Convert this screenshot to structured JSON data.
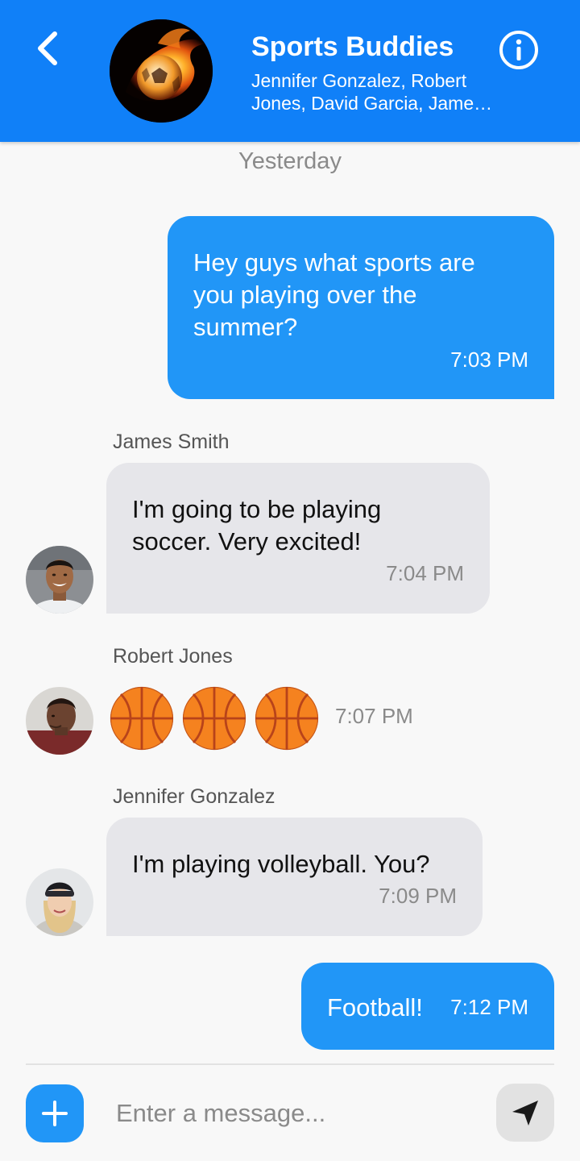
{
  "header": {
    "title": "Sports Buddies",
    "members": "Jennifer Gonzalez, Robert Jones, David Garcia, James Smith",
    "back_icon": "chevron-left-icon",
    "info_icon": "info-icon",
    "accent_color": "#1080f8"
  },
  "date_divider": "Yesterday",
  "messages": [
    {
      "direction": "outgoing",
      "text": "Hey guys what sports are you playing over the summer?",
      "time": "7:03 PM"
    },
    {
      "direction": "incoming",
      "sender": "James Smith",
      "text": "I'm going to be playing soccer. Very excited!",
      "time": "7:04 PM"
    },
    {
      "direction": "incoming",
      "sender": "Robert Jones",
      "emoji": [
        "basketball-icon",
        "basketball-icon",
        "basketball-icon"
      ],
      "time": "7:07 PM"
    },
    {
      "direction": "incoming",
      "sender": "Jennifer Gonzalez",
      "text": "I'm playing volleyball. You?",
      "time": "7:09 PM"
    },
    {
      "direction": "outgoing",
      "text": "Football!",
      "time": "7:12 PM"
    }
  ],
  "composer": {
    "placeholder": "Enter a message...",
    "add_icon": "plus-icon",
    "send_icon": "send-icon"
  },
  "colors": {
    "outgoing_bubble": "#2196f7",
    "incoming_bubble": "#e6e6ea",
    "background": "#f8f8f8"
  }
}
